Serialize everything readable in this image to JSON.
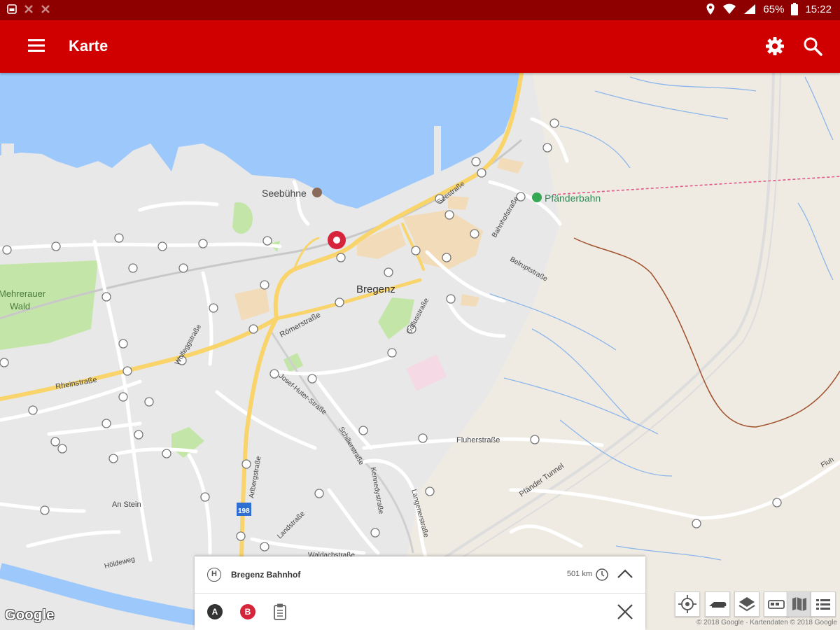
{
  "status_bar": {
    "battery": "65%",
    "time": "15:22"
  },
  "app_bar": {
    "title": "Karte"
  },
  "map": {
    "labels": {
      "seebuehne": "Seebühne",
      "pfaenderbahn": "Pfänderbahn",
      "bregenz": "Bregenz",
      "mehrerauer_wald_1": "Mehrerauer",
      "mehrerauer_wald_2": "Wald",
      "rheinstrasse": "Rheinstraße",
      "roemerstrasse": "Römerstraße",
      "fluherstrasse": "Fluherstraße",
      "pfaender_tunnel": "Pfänder Tunnel",
      "route_198": "198",
      "seestrasse": "Seestraße",
      "belruptstrasse": "Belruptstraße",
      "bahnhofstrasse": "Bahnhofstraße",
      "wolfeggstrasse": "Wolfeggstraße",
      "gallusstrasse": "Gallusstraße",
      "josef_huter": "Josef-Huter-Straße",
      "arlbergstrasse": "Arlbergstraße",
      "landstrasse": "Landstraße",
      "an_stein": "An Stein",
      "waldachstrasse": "Waldachstraße",
      "hoelderweg": "Höldeweg",
      "schillerstrasse": "Schillerstraße",
      "kennedystrasse": "Kennedystraße",
      "langenerstrasse": "Langenerstraße",
      "fluh": "Fluh"
    },
    "colors": {
      "water": "#9dc8fb",
      "road_major": "#f8d46a",
      "park": "#c3e6a8",
      "land": "#e8e8e8",
      "terrain": "#efebe3",
      "brand_red": "#d10000"
    }
  },
  "route_panel": {
    "stop_name": "Bregenz Bahnhof",
    "stop_icon": "H",
    "distance": "501 km",
    "point_a": "A",
    "point_b": "B"
  },
  "map_controls": [
    "locate-icon",
    "train-icon",
    "layers-icon",
    "transit-mode-icon",
    "map-mode-icon",
    "list-mode-icon"
  ],
  "attribution": {
    "logo": "Google",
    "text": "© 2018 Google · Kartendaten © 2018 Google"
  }
}
